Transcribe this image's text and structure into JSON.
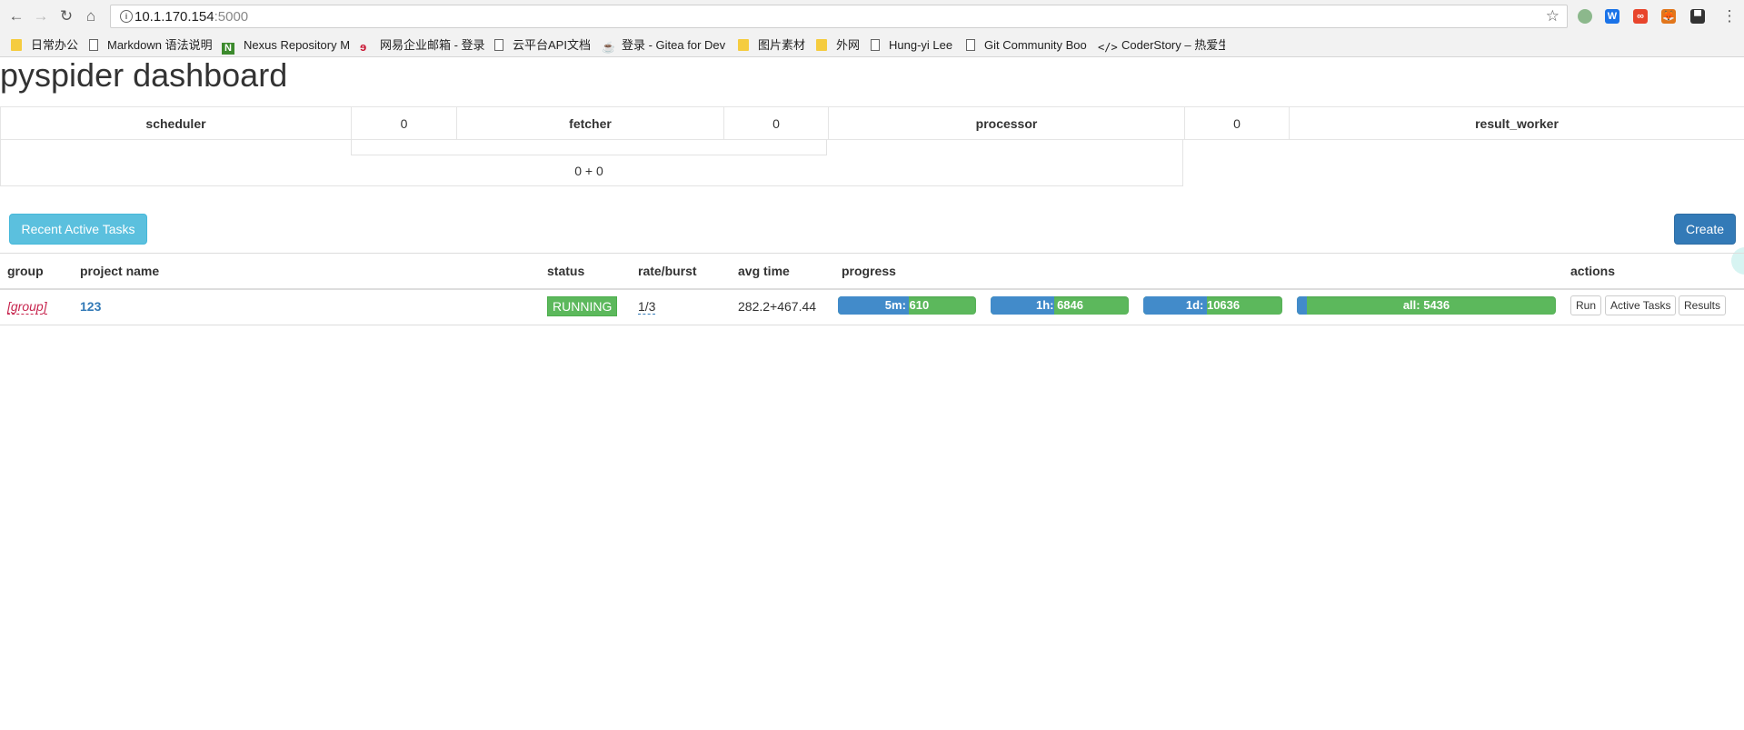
{
  "browser": {
    "url_host": "10.1.170.154",
    "url_port": ":5000",
    "bookmarks": [
      {
        "label": "日常办公",
        "icon": "folder-icon"
      },
      {
        "label": "Markdown 语法说明",
        "icon": "page-icon"
      },
      {
        "label": "Nexus Repository M",
        "icon": "nexus-icon"
      },
      {
        "label": "网易企业邮箱 - 登录",
        "icon": "netease-icon"
      },
      {
        "label": "云平台API文档",
        "icon": "page-icon"
      },
      {
        "label": "登录 - Gitea for Dev",
        "icon": "gitea-icon"
      },
      {
        "label": "图片素材",
        "icon": "folder-icon"
      },
      {
        "label": "外网",
        "icon": "folder-icon"
      },
      {
        "label": "Hung-yi Lee",
        "icon": "page-icon"
      },
      {
        "label": "Git Community Boo",
        "icon": "page-icon"
      },
      {
        "label": "CoderStory – 热爱生",
        "icon": "code-icon"
      }
    ],
    "extensions": [
      {
        "name": "grey-circle-extension-icon",
        "color": "#8cb88c",
        "glyph": ""
      },
      {
        "name": "w-extension-icon",
        "color": "#1a73e8",
        "glyph": "W"
      },
      {
        "name": "oo-extension-icon",
        "color": "#e8452c",
        "glyph": "∞"
      },
      {
        "name": "fox-extension-icon",
        "color": "#e2761b",
        "glyph": "🦊"
      },
      {
        "name": "dark-extension-icon",
        "color": "#333333",
        "glyph": "▀"
      }
    ]
  },
  "page": {
    "title": "pyspider dashboard"
  },
  "queues": {
    "scheduler_label": "scheduler",
    "scheduler_count": "0",
    "fetcher_label": "fetcher",
    "fetcher_count": "0",
    "processor_label": "processor",
    "processor_count": "0",
    "result_worker_label": "result_worker",
    "total": "0 + 0"
  },
  "buttons": {
    "recent_active_tasks": "Recent Active Tasks",
    "create": "Create"
  },
  "projects": {
    "headers": {
      "group": "group",
      "project_name": "project name",
      "status": "status",
      "rate_burst": "rate/burst",
      "avg_time": "avg time",
      "progress": "progress",
      "actions": "actions"
    },
    "rows": [
      {
        "group": "[group]",
        "name": "123",
        "status": "RUNNING",
        "rate_burst": "1/3",
        "avg_time": "282.2+467.44",
        "progress": [
          {
            "label": "5m: 610",
            "done_fraction": 0.51
          },
          {
            "label": "1h: 6846",
            "done_fraction": 0.46
          },
          {
            "label": "1d: 10636",
            "done_fraction": 0.46
          },
          {
            "label": "all: 5436",
            "done_fraction": 0.04
          }
        ],
        "actions": {
          "run": "Run",
          "active_tasks": "Active Tasks",
          "results": "Results"
        }
      }
    ]
  },
  "colors": {
    "progress_done": "#428bca",
    "progress_remaining": "#5cb85c",
    "status_running": "#5cb85c",
    "info_button": "#5bc0de",
    "primary_button": "#337ab7"
  }
}
